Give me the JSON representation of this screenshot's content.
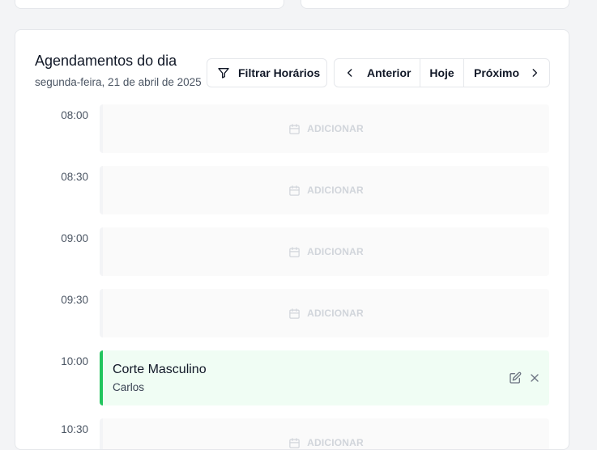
{
  "schedule": {
    "title": "Agendamentos do dia",
    "date": "segunda-feira, 21 de abril de 2025",
    "filter_label": "Filtrar Horários",
    "nav": {
      "prev_label": "Anterior",
      "today_label": "Hoje",
      "next_label": "Próximo"
    },
    "add_label": "ADICIONAR",
    "slots": [
      {
        "time": "08:00",
        "status": "empty"
      },
      {
        "time": "08:30",
        "status": "empty"
      },
      {
        "time": "09:00",
        "status": "empty"
      },
      {
        "time": "09:30",
        "status": "empty"
      },
      {
        "time": "10:00",
        "status": "booked",
        "service": "Corte Masculino",
        "client": "Carlos"
      },
      {
        "time": "10:30",
        "status": "empty"
      }
    ]
  },
  "colors": {
    "booked_accent": "#22c55e",
    "booked_bg": "#f0fdf4",
    "empty_bg": "#fafafa",
    "muted_text": "#d1d5db"
  },
  "icons": {
    "filter": "filter-icon",
    "prev": "chevron-left-icon",
    "next": "chevron-right-icon",
    "add": "calendar-icon",
    "edit": "edit-icon",
    "cancel": "close-icon"
  }
}
